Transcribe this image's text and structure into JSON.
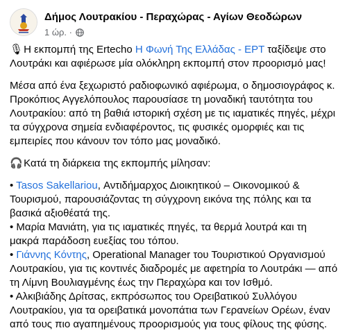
{
  "header": {
    "page_name": "Δήμος Λουτρακίου - Περαχώρας - Αγίων Θεοδώρων",
    "time": "1 ώρ.",
    "separator": "·",
    "audience_icon": "globe-icon",
    "avatar_icon": "municipality-logo"
  },
  "post": {
    "p1": {
      "emoji": "🎙",
      "text_before": " Η εκπομπή της Ertecho ",
      "link": "Η Φωνή Της Ελλάδας - ΕΡΤ",
      "text_after": " ταξίδεψε στο Λουτράκι και αφιέρωσε μία ολόκληρη εκπομπή στον προορισμό μας!"
    },
    "p2": "Μέσα από ένα ξεχωριστό ραδιοφωνικό αφιέρωμα, ο δημοσιογράφος κ. Προκόπιος Αγγελόπουλος παρουσίασε τη μοναδική ταυτότητα του Λουτρακίου: από τη βαθιά ιστορική σχέση με τις ιαματικές πηγές, μέχρι τα σύγχρονα σημεία ενδιαφέροντος, τις φυσικές ομορφιές και τις εμπειρίες που κάνουν τον τόπο μας μοναδικό.",
    "p3": {
      "emoji": "🎧",
      "text": " Κατά τη διάρκεια της εκπομπής μίλησαν:"
    },
    "speakers": [
      {
        "bullet": "• ",
        "mention": " Tasos Sakellariou",
        "text": ", Αντιδήμαρχος Διοικητικού – Οικονομικού & Τουρισμού, παρουσιάζοντας τη σύγχρονη εικόνα της πόλης και τα βασικά αξιοθέατά της."
      },
      {
        "bullet": "• ",
        "mention": "",
        "text": "Μαρία Μανιάτη, για τις ιαματικές πηγές, τα θερμά λουτρά και τη μακρά παράδοση ευεξίας του τόπου."
      },
      {
        "bullet": "• ",
        "mention": "Γιάννης Κόντης",
        "text": ", Operational Manager του Τουριστικού Οργανισμού Λουτρακίου, για τις κοντινές διαδρομές με αφετηρία το Λουτράκι — από τη Λίμνη Βουλιαγμένης έως την Περαχώρα και τον Ισθμό."
      },
      {
        "bullet": "• ",
        "mention": "",
        "text": "Αλκιβιάδης Δρίτσας, εκπρόσωπος του Ορειβατικού Συλλόγου Λουτρακίου, για τα ορειβατικά μονοπάτια των Γερανείων Ορέων, έναν από τους πιο αγαπημένους προορισμούς για τους φίλους της φύσης."
      }
    ]
  }
}
